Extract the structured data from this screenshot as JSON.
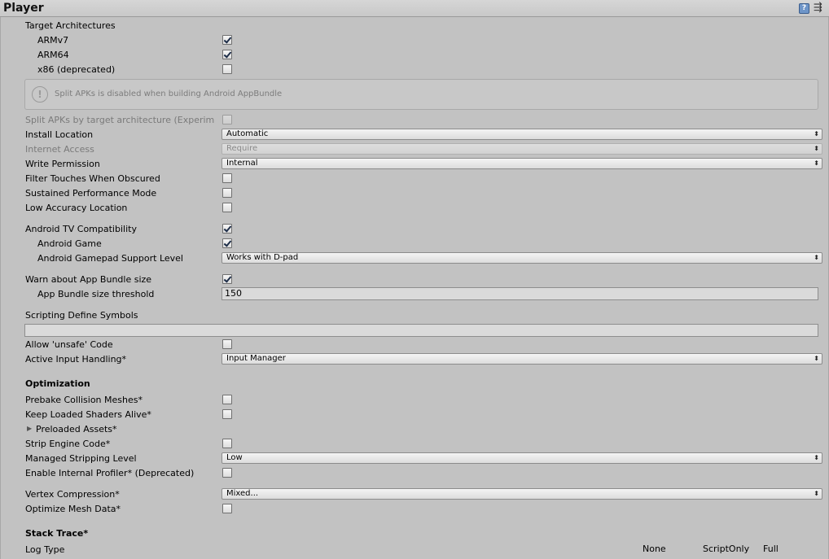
{
  "window": {
    "title": "Player",
    "help_icon": "?",
    "settings_icon": "⇶"
  },
  "target_architectures": {
    "heading": "Target Architectures",
    "armv7": "ARMv7",
    "arm64": "ARM64",
    "x86": "x86 (deprecated)"
  },
  "help_message": "Split APKs is disabled when building Android AppBundle",
  "rows": {
    "split_apks": "Split APKs by target architecture (Experim",
    "install_location": "Install Location",
    "install_location_value": "Automatic",
    "internet_access": "Internet Access",
    "internet_access_value": "Require",
    "write_permission": "Write Permission",
    "write_permission_value": "Internal",
    "filter_touches": "Filter Touches When Obscured",
    "sustained_perf": "Sustained Performance Mode",
    "low_accuracy": "Low Accuracy Location",
    "android_tv": "Android TV Compatibility",
    "android_game": "Android Game",
    "gamepad_support": "Android Gamepad Support Level",
    "gamepad_support_value": "Works with D-pad",
    "warn_bundle": "Warn about App Bundle size",
    "bundle_threshold": "App Bundle size threshold",
    "bundle_threshold_value": "150",
    "scripting_define": "Scripting Define Symbols",
    "allow_unsafe": "Allow 'unsafe' Code",
    "active_input": "Active Input Handling*",
    "active_input_value": "Input Manager"
  },
  "optimization": {
    "heading": "Optimization",
    "prebake": "Prebake Collision Meshes*",
    "keep_shaders": "Keep Loaded Shaders Alive*",
    "preloaded_assets": "Preloaded Assets*",
    "strip_engine": "Strip Engine Code*",
    "managed_stripping": "Managed Stripping Level",
    "managed_stripping_value": "Low",
    "internal_profiler": "Enable Internal Profiler* (Deprecated)",
    "vertex_compression": "Vertex Compression*",
    "vertex_compression_value": "Mixed...",
    "optimize_mesh": "Optimize Mesh Data*"
  },
  "stack_trace": {
    "heading": "Stack Trace*",
    "log_type": "Log Type",
    "columns": [
      "None",
      "ScriptOnly",
      "Full"
    ]
  }
}
